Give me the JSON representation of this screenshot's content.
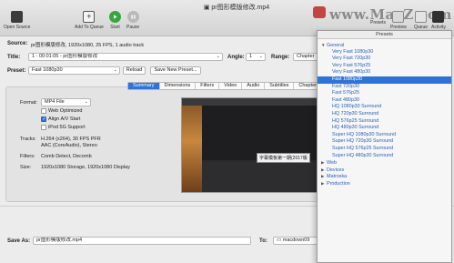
{
  "window": {
    "title": "pr图形模版修改.mp4"
  },
  "toolbar": {
    "open_source": "Open Source",
    "add_to_queue": "Add To Queue",
    "start": "Start",
    "pause": "Pause",
    "presets": "Presets",
    "preview": "Preview",
    "queue": "Queue",
    "activity": "Activity",
    "watermark": "www.MacZ.com"
  },
  "source": {
    "label": "Source:",
    "value": "pr图形模版修改, 1920x1080, 25 FPS, 1 audio track"
  },
  "title_row": {
    "label": "Title:",
    "value": "1 - 00:01:05 - pr图形模版修改",
    "angle_label": "Angle:",
    "angle_value": "1",
    "range_label": "Range:",
    "range_value": "Chapter"
  },
  "preset_row": {
    "label": "Preset:",
    "value": "Fast 1080p30",
    "reload": "Reload",
    "save_new": "Save New Preset..."
  },
  "tabs": [
    "Summary",
    "Dimensions",
    "Filters",
    "Video",
    "Audio",
    "Subtitles",
    "Chapters"
  ],
  "summary": {
    "format_label": "Format:",
    "format_value": "MP4 File",
    "web_optimized": "Web Optimized",
    "align_av": "Align A/V Start",
    "ipod": "iPod 5G Support",
    "tracks_label": "Tracks:",
    "tracks_line1": "H.264 (x264), 30 FPS PFR",
    "tracks_line2": "AAC (CoreAudio), Stereo",
    "filters_label": "Filters:",
    "filters_value": "Comb Detect, Decomb",
    "size_label": "Size:",
    "size_value": "1920x1080 Storage, 1920x1080 Display",
    "preview_caption": "字幕模板第一期(2017版"
  },
  "save_as": {
    "label": "Save As:",
    "value": "pr图形模版修改.mp4",
    "to_label": "To:",
    "to_value": "macdown09"
  },
  "presets_panel": {
    "header": "Presets",
    "groups": [
      {
        "name": "General",
        "expanded": true,
        "items": [
          "Very Fast 1080p30",
          "Very Fast 720p30",
          "Very Fast 576p25",
          "Very Fast 480p30",
          "Fast 1080p30",
          "Fast 720p30",
          "Fast 576p25",
          "Fast 480p30",
          "HQ 1080p30 Surround",
          "HQ 720p30 Surround",
          "HQ 576p25 Surround",
          "HQ 480p30 Surround",
          "Super HQ 1080p30 Surround",
          "Super HQ 720p30 Surround",
          "Super HQ 576p25 Surround",
          "Super HQ 480p30 Surround"
        ]
      },
      {
        "name": "Web",
        "expanded": false
      },
      {
        "name": "Devices",
        "expanded": false
      },
      {
        "name": "Matroska",
        "expanded": false
      },
      {
        "name": "Production",
        "expanded": false
      }
    ],
    "selected": "Fast 1080p30"
  },
  "colors": {
    "accent": "#2f73d8",
    "start_green": "#35a83d",
    "preset_text": "#2a5fb5"
  }
}
